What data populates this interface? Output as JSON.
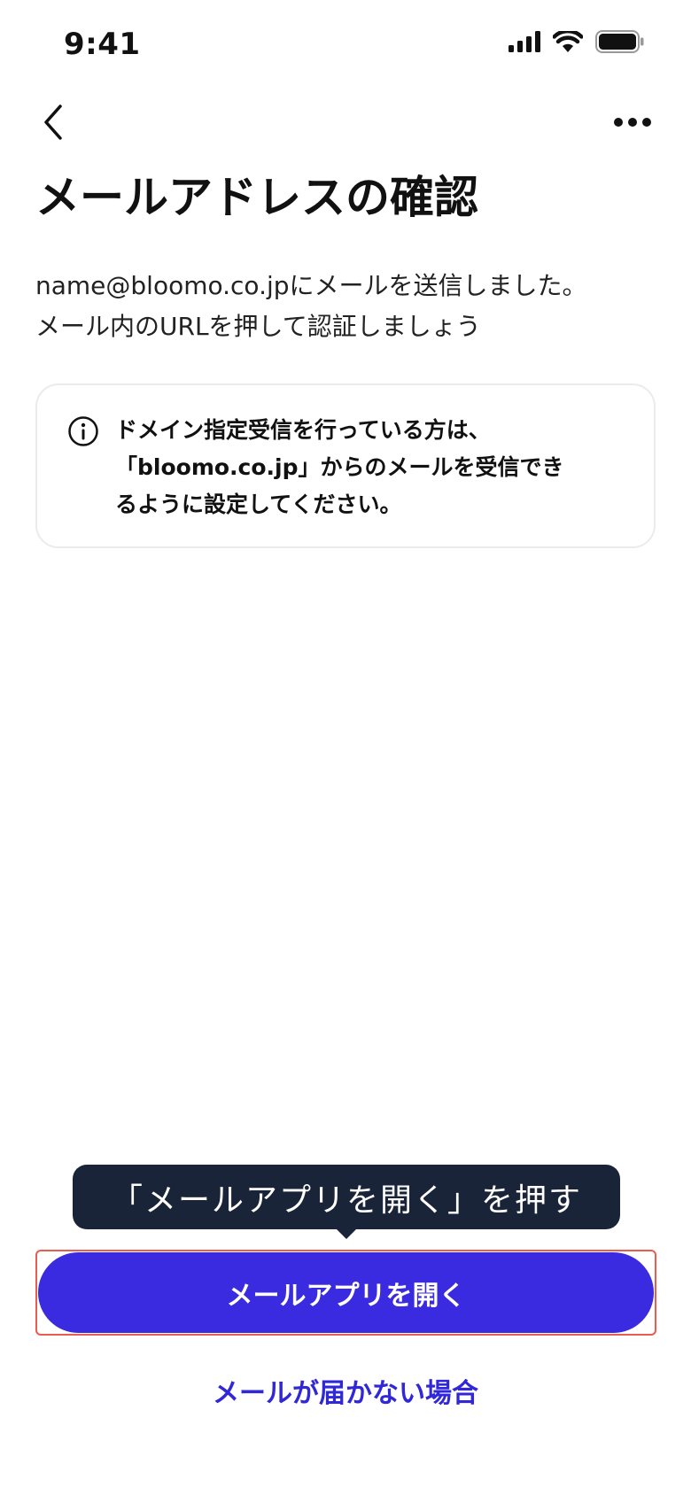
{
  "status_bar": {
    "time": "9:41",
    "icons": [
      "signal-icon",
      "wifi-icon",
      "battery-icon"
    ]
  },
  "nav": {
    "back_icon": "chevron-left-icon",
    "more_icon": "more-horizontal-icon"
  },
  "page": {
    "title": "メールアドレスの確認",
    "description_lines": [
      "name@bloomo.co.jpにメールを送信しました。",
      "メール内のURLを押して認証しましょう"
    ]
  },
  "info_card": {
    "icon": "info-icon",
    "lines": [
      "ドメイン指定受信を行っている方は、",
      "「bloomo.co.jp」からのメールを受信でき",
      "るように設定してください。"
    ]
  },
  "tooltip": {
    "text": "「メールアプリを開く」を押す"
  },
  "actions": {
    "open_mail_label": "メールアプリを開く",
    "not_received_label": "メールが届かない場合"
  },
  "colors": {
    "primary": "#3a2be0",
    "link": "#2f27d8",
    "tooltip_bg": "#1a2438",
    "highlight": "#ec5b4f",
    "card_border": "#ebebeb"
  }
}
